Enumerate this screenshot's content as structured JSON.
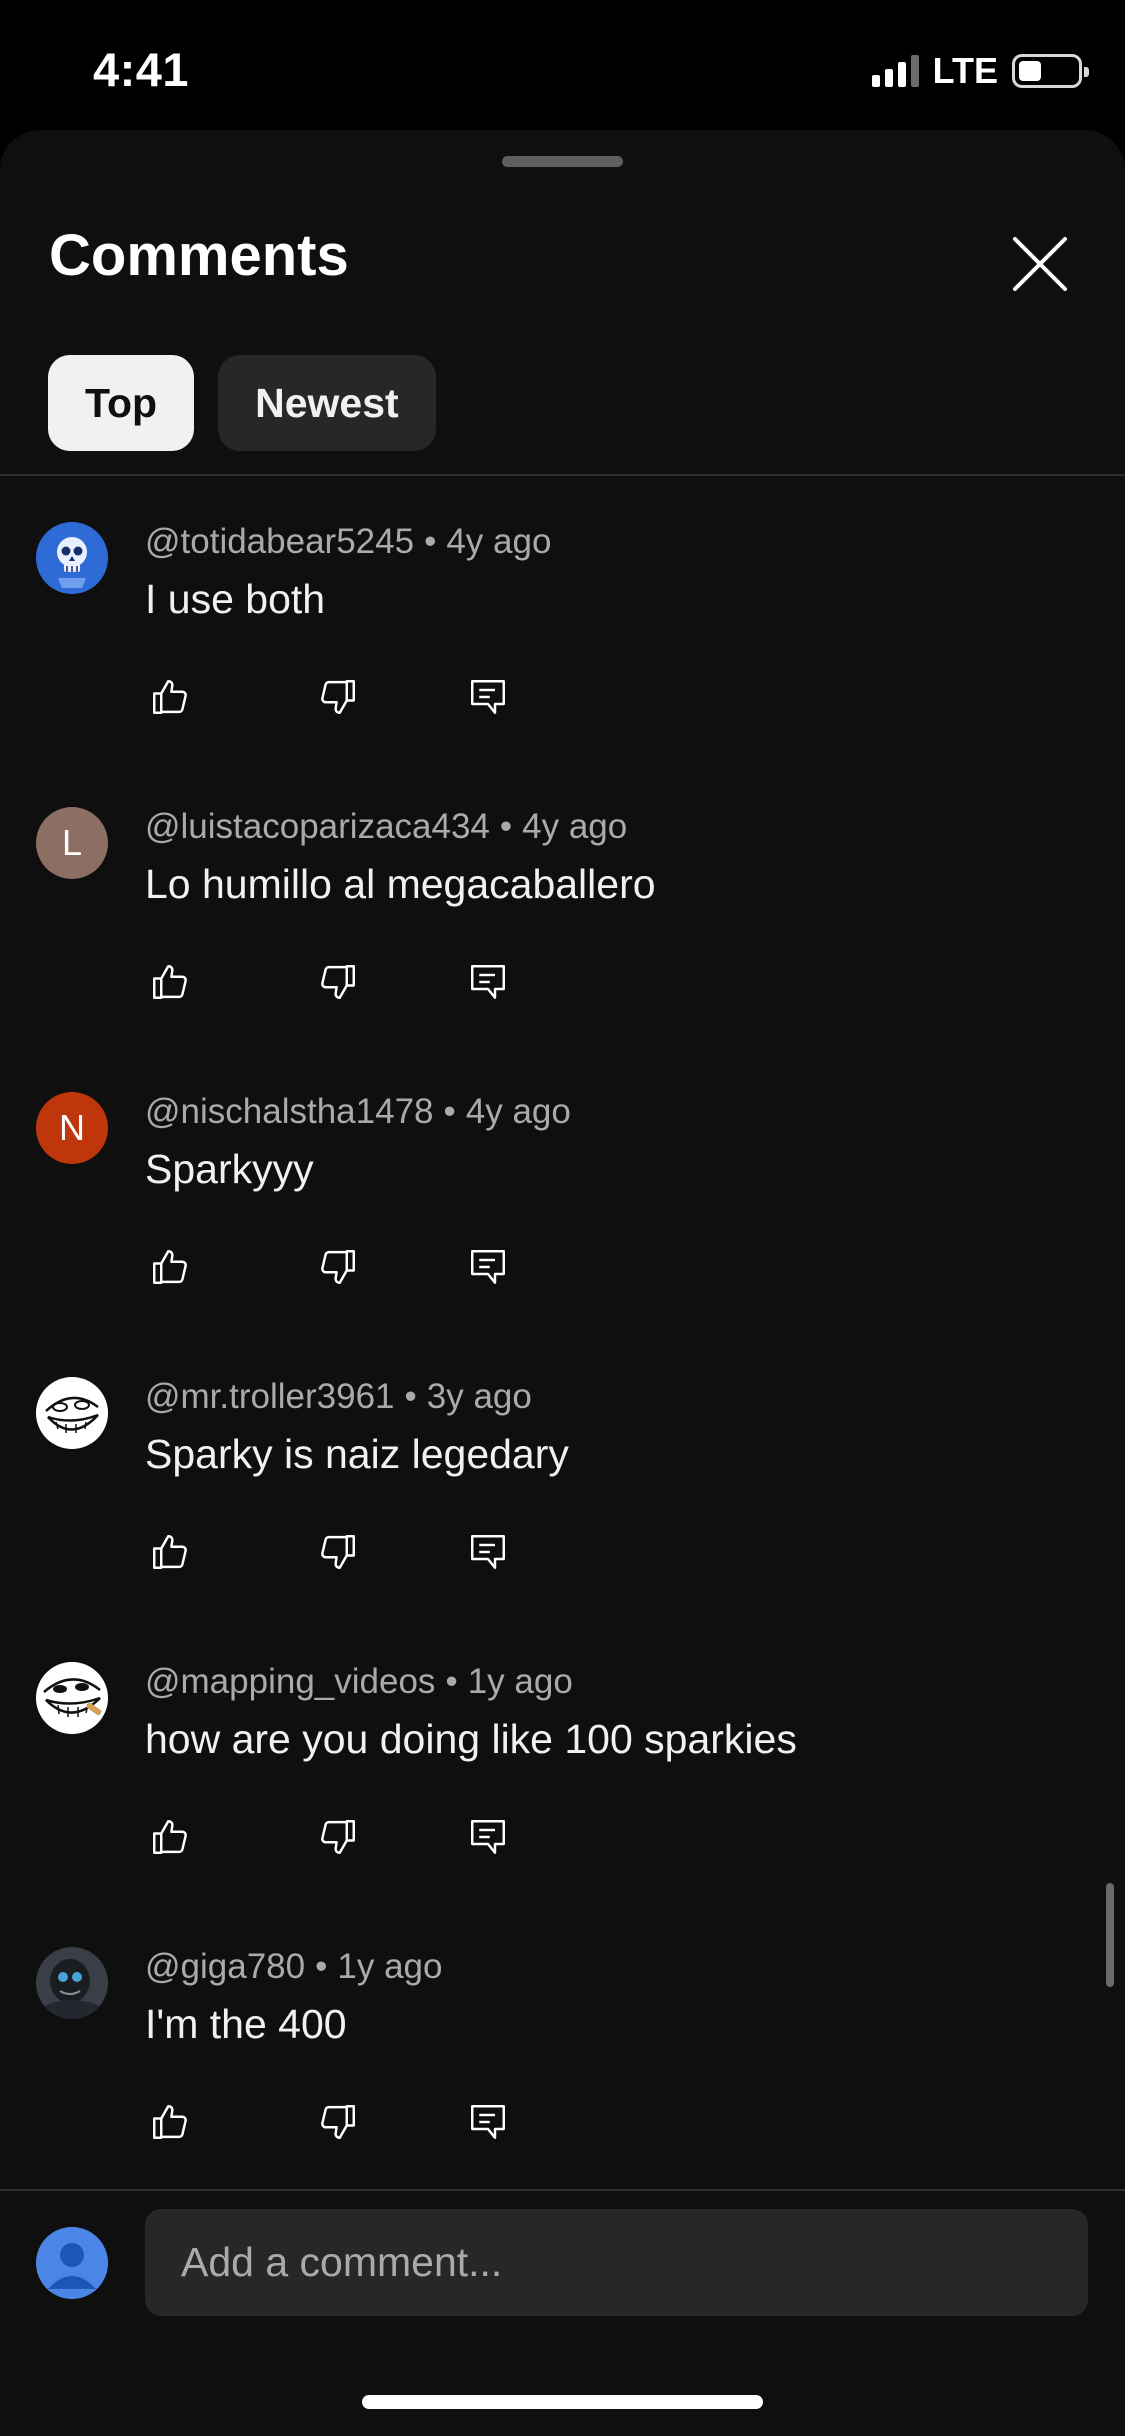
{
  "status": {
    "time": "4:41",
    "network": "LTE"
  },
  "sheet": {
    "title": "Comments",
    "tabs": [
      {
        "label": "Top",
        "active": true
      },
      {
        "label": "Newest",
        "active": false
      }
    ]
  },
  "comments": [
    {
      "author": "@totidabear5245",
      "age": "4y ago",
      "text": "I use both",
      "avatar": "skull-avatar-icon"
    },
    {
      "author": "@luistacoparizaca434",
      "age": "4y ago",
      "text": "Lo humillo al megacaballero",
      "avatar_letter": "L",
      "avatar_color": "#8d6e63"
    },
    {
      "author": "@nischalstha1478",
      "age": "4y ago",
      "text": "Sparkyyy",
      "avatar_letter": "N",
      "avatar_color": "#bf360c"
    },
    {
      "author": "@mr.troller3961",
      "age": "3y ago",
      "text": "Sparky is naiz legedary",
      "avatar": "trollface-avatar-icon"
    },
    {
      "author": "@mapping_videos",
      "age": "1y ago",
      "text": "how are you doing like 100 sparkies",
      "avatar": "trollface-avatar-icon"
    },
    {
      "author": "@giga780",
      "age": "1y ago",
      "text": "I'm the 400",
      "avatar": "dark-figure-avatar-icon"
    }
  ],
  "separator": "•",
  "input": {
    "placeholder": "Add a comment..."
  },
  "icons": {
    "like": "thumb-up-icon",
    "dislike": "thumb-down-icon",
    "reply": "reply-icon",
    "close": "close-icon"
  },
  "colors": {
    "background": "#0f0f0f",
    "chip_active": "#f1f1f1",
    "chip_inactive": "#272727",
    "meta_text": "#aaaaaa"
  }
}
